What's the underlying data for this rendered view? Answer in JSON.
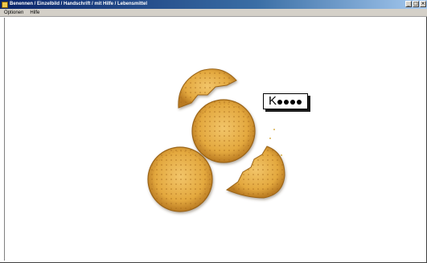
{
  "window": {
    "title": "Benennen / Einzelbild / Handschrift / mit Hilfe / Lebensmittel"
  },
  "menu": {
    "items": [
      "Optionen",
      "Hilfe"
    ]
  },
  "word_prompt": {
    "letter": "K",
    "hidden_letters": 4
  },
  "image": {
    "subject": "butter-biscuits-icon"
  }
}
